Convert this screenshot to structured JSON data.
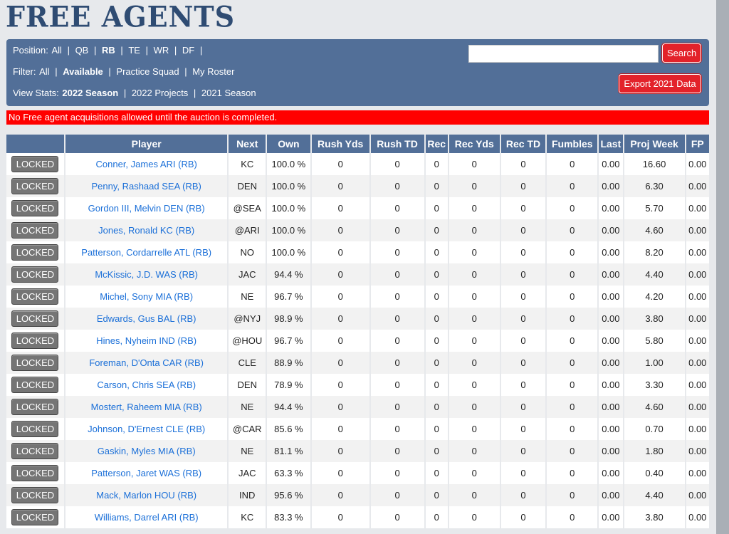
{
  "page_title": "FREE AGENTS",
  "position_filter": {
    "label": "Position:",
    "options": [
      {
        "label": "All",
        "active": false
      },
      {
        "label": "QB",
        "active": false
      },
      {
        "label": "RB",
        "active": true
      },
      {
        "label": "TE",
        "active": false
      },
      {
        "label": "WR",
        "active": false
      },
      {
        "label": "DF",
        "active": false
      }
    ]
  },
  "status_filter": {
    "label": "Filter:",
    "options": [
      {
        "label": "All",
        "active": false
      },
      {
        "label": "Available",
        "active": true
      },
      {
        "label": "Practice Squad",
        "active": false
      },
      {
        "label": "My Roster",
        "active": false
      }
    ]
  },
  "view_stats": {
    "label": "View Stats:",
    "options": [
      {
        "label": "2022 Season",
        "active": true
      },
      {
        "label": "2022 Projects",
        "active": false
      },
      {
        "label": "2021 Season",
        "active": false
      }
    ]
  },
  "search": {
    "value": "",
    "button_label": "Search"
  },
  "export_label": "Export 2021 Data",
  "warning": "No Free agent acquisitions allowed until the auction is completed.",
  "table": {
    "columns": [
      "",
      "Player",
      "Next",
      "Own",
      "Rush Yds",
      "Rush TD",
      "Rec",
      "Rec Yds",
      "Rec TD",
      "Fumbles",
      "Last",
      "Proj Week",
      "FP"
    ],
    "button_label": "LOCKED",
    "rows": [
      {
        "player": "Conner, James ARI (RB)",
        "next": "KC",
        "own": "100.0 %",
        "rush_yds": "0",
        "rush_td": "0",
        "rec": "0",
        "rec_yds": "0",
        "rec_td": "0",
        "fumbles": "0",
        "last": "0.00",
        "proj": "16.60",
        "fp": "0.00"
      },
      {
        "player": "Penny, Rashaad SEA (RB)",
        "next": "DEN",
        "own": "100.0 %",
        "rush_yds": "0",
        "rush_td": "0",
        "rec": "0",
        "rec_yds": "0",
        "rec_td": "0",
        "fumbles": "0",
        "last": "0.00",
        "proj": "6.30",
        "fp": "0.00"
      },
      {
        "player": "Gordon III, Melvin DEN (RB)",
        "next": "@SEA",
        "own": "100.0 %",
        "rush_yds": "0",
        "rush_td": "0",
        "rec": "0",
        "rec_yds": "0",
        "rec_td": "0",
        "fumbles": "0",
        "last": "0.00",
        "proj": "5.70",
        "fp": "0.00"
      },
      {
        "player": "Jones, Ronald KC (RB)",
        "next": "@ARI",
        "own": "100.0 %",
        "rush_yds": "0",
        "rush_td": "0",
        "rec": "0",
        "rec_yds": "0",
        "rec_td": "0",
        "fumbles": "0",
        "last": "0.00",
        "proj": "4.60",
        "fp": "0.00"
      },
      {
        "player": "Patterson, Cordarrelle ATL (RB)",
        "next": "NO",
        "own": "100.0 %",
        "rush_yds": "0",
        "rush_td": "0",
        "rec": "0",
        "rec_yds": "0",
        "rec_td": "0",
        "fumbles": "0",
        "last": "0.00",
        "proj": "8.20",
        "fp": "0.00"
      },
      {
        "player": "McKissic, J.D. WAS (RB)",
        "next": "JAC",
        "own": "94.4 %",
        "rush_yds": "0",
        "rush_td": "0",
        "rec": "0",
        "rec_yds": "0",
        "rec_td": "0",
        "fumbles": "0",
        "last": "0.00",
        "proj": "4.40",
        "fp": "0.00"
      },
      {
        "player": "Michel, Sony MIA (RB)",
        "next": "NE",
        "own": "96.7 %",
        "rush_yds": "0",
        "rush_td": "0",
        "rec": "0",
        "rec_yds": "0",
        "rec_td": "0",
        "fumbles": "0",
        "last": "0.00",
        "proj": "4.20",
        "fp": "0.00"
      },
      {
        "player": "Edwards, Gus BAL (RB)",
        "next": "@NYJ",
        "own": "98.9 %",
        "rush_yds": "0",
        "rush_td": "0",
        "rec": "0",
        "rec_yds": "0",
        "rec_td": "0",
        "fumbles": "0",
        "last": "0.00",
        "proj": "3.80",
        "fp": "0.00"
      },
      {
        "player": "Hines, Nyheim IND (RB)",
        "next": "@HOU",
        "own": "96.7 %",
        "rush_yds": "0",
        "rush_td": "0",
        "rec": "0",
        "rec_yds": "0",
        "rec_td": "0",
        "fumbles": "0",
        "last": "0.00",
        "proj": "5.80",
        "fp": "0.00"
      },
      {
        "player": "Foreman, D'Onta CAR (RB)",
        "next": "CLE",
        "own": "88.9 %",
        "rush_yds": "0",
        "rush_td": "0",
        "rec": "0",
        "rec_yds": "0",
        "rec_td": "0",
        "fumbles": "0",
        "last": "0.00",
        "proj": "1.00",
        "fp": "0.00"
      },
      {
        "player": "Carson, Chris SEA (RB)",
        "next": "DEN",
        "own": "78.9 %",
        "rush_yds": "0",
        "rush_td": "0",
        "rec": "0",
        "rec_yds": "0",
        "rec_td": "0",
        "fumbles": "0",
        "last": "0.00",
        "proj": "3.30",
        "fp": "0.00"
      },
      {
        "player": "Mostert, Raheem MIA (RB)",
        "next": "NE",
        "own": "94.4 %",
        "rush_yds": "0",
        "rush_td": "0",
        "rec": "0",
        "rec_yds": "0",
        "rec_td": "0",
        "fumbles": "0",
        "last": "0.00",
        "proj": "4.60",
        "fp": "0.00"
      },
      {
        "player": "Johnson, D'Ernest CLE (RB)",
        "next": "@CAR",
        "own": "85.6 %",
        "rush_yds": "0",
        "rush_td": "0",
        "rec": "0",
        "rec_yds": "0",
        "rec_td": "0",
        "fumbles": "0",
        "last": "0.00",
        "proj": "0.70",
        "fp": "0.00"
      },
      {
        "player": "Gaskin, Myles MIA (RB)",
        "next": "NE",
        "own": "81.1 %",
        "rush_yds": "0",
        "rush_td": "0",
        "rec": "0",
        "rec_yds": "0",
        "rec_td": "0",
        "fumbles": "0",
        "last": "0.00",
        "proj": "1.80",
        "fp": "0.00"
      },
      {
        "player": "Patterson, Jaret WAS (RB)",
        "next": "JAC",
        "own": "63.3 %",
        "rush_yds": "0",
        "rush_td": "0",
        "rec": "0",
        "rec_yds": "0",
        "rec_td": "0",
        "fumbles": "0",
        "last": "0.00",
        "proj": "0.40",
        "fp": "0.00"
      },
      {
        "player": "Mack, Marlon HOU (RB)",
        "next": "IND",
        "own": "95.6 %",
        "rush_yds": "0",
        "rush_td": "0",
        "rec": "0",
        "rec_yds": "0",
        "rec_td": "0",
        "fumbles": "0",
        "last": "0.00",
        "proj": "4.40",
        "fp": "0.00"
      },
      {
        "player": "Williams, Darrel ARI (RB)",
        "next": "KC",
        "own": "83.3 %",
        "rush_yds": "0",
        "rush_td": "0",
        "rec": "0",
        "rec_yds": "0",
        "rec_td": "0",
        "fumbles": "0",
        "last": "0.00",
        "proj": "3.80",
        "fp": "0.00"
      }
    ]
  },
  "colors": {
    "header_blue": "#526f98",
    "title_blue": "#2f4c73",
    "accent_red": "#e3222a",
    "warning_red": "#ff0000",
    "link_blue": "#1a6fd8",
    "locked_gray": "#757575"
  }
}
